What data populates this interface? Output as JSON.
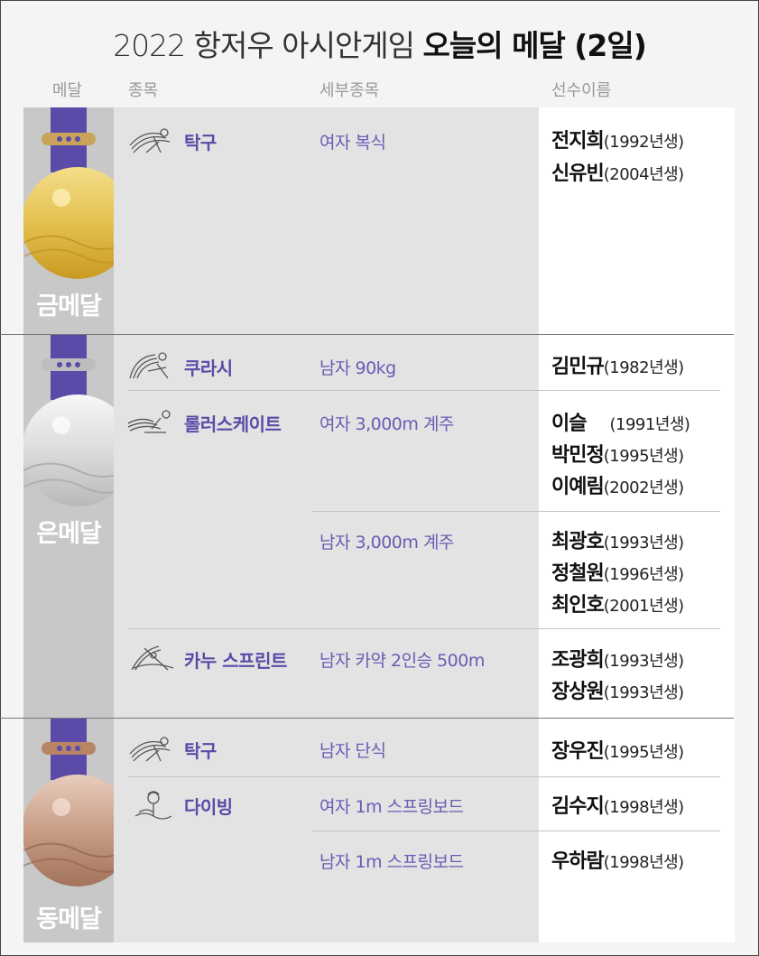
{
  "title": {
    "light": "2022 항저우 아시안게임",
    "bold": "오늘의 메달 (2일)"
  },
  "headers": {
    "medal": "메달",
    "sport": "종목",
    "event": "세부종목",
    "athlete": "선수이름"
  },
  "medals": {
    "gold": {
      "label": "금메달",
      "color": "#d9b43a"
    },
    "silver": {
      "label": "은메달",
      "color": "#c9c9c9"
    },
    "bronze": {
      "label": "동메달",
      "color": "#b8907a"
    }
  },
  "accent": "#5b4aa8",
  "gold": {
    "sport1": "탁구",
    "event1": "여자 복식",
    "a1": "전지희",
    "y1": "(1992년생)",
    "a2": "신유빈",
    "y2": "(2004년생)"
  },
  "silver": {
    "sport1": "쿠라시",
    "event1": "남자 90kg",
    "a1": "김민규",
    "y1": "(1982년생)",
    "sport2": "롤러스케이트",
    "event2": "여자 3,000m 계주",
    "a2": "이슬",
    "y2": "(1991년생)",
    "a3": "박민정",
    "y3": "(1995년생)",
    "a4": "이예림",
    "y4": "(2002년생)",
    "event3": "남자 3,000m 계주",
    "a5": "최광호",
    "y5": "(1993년생)",
    "a6": "정철원",
    "y6": "(1996년생)",
    "a7": "최인호",
    "y7": "(2001년생)",
    "sport3": "카누 스프린트",
    "event4": "남자 카약 2인승 500m",
    "a8": "조광희",
    "y8": "(1993년생)",
    "a9": "장상원",
    "y9": "(1993년생)"
  },
  "bronze": {
    "sport1": "탁구",
    "event1": "남자 단식",
    "a1": "장우진",
    "y1": "(1995년생)",
    "sport2": "다이빙",
    "event2": "여자 1m 스프링보드",
    "a2": "김수지",
    "y2": "(1998년생)",
    "event3": "남자 1m 스프링보드",
    "a3": "우하람",
    "y3": "(1998년생)"
  }
}
